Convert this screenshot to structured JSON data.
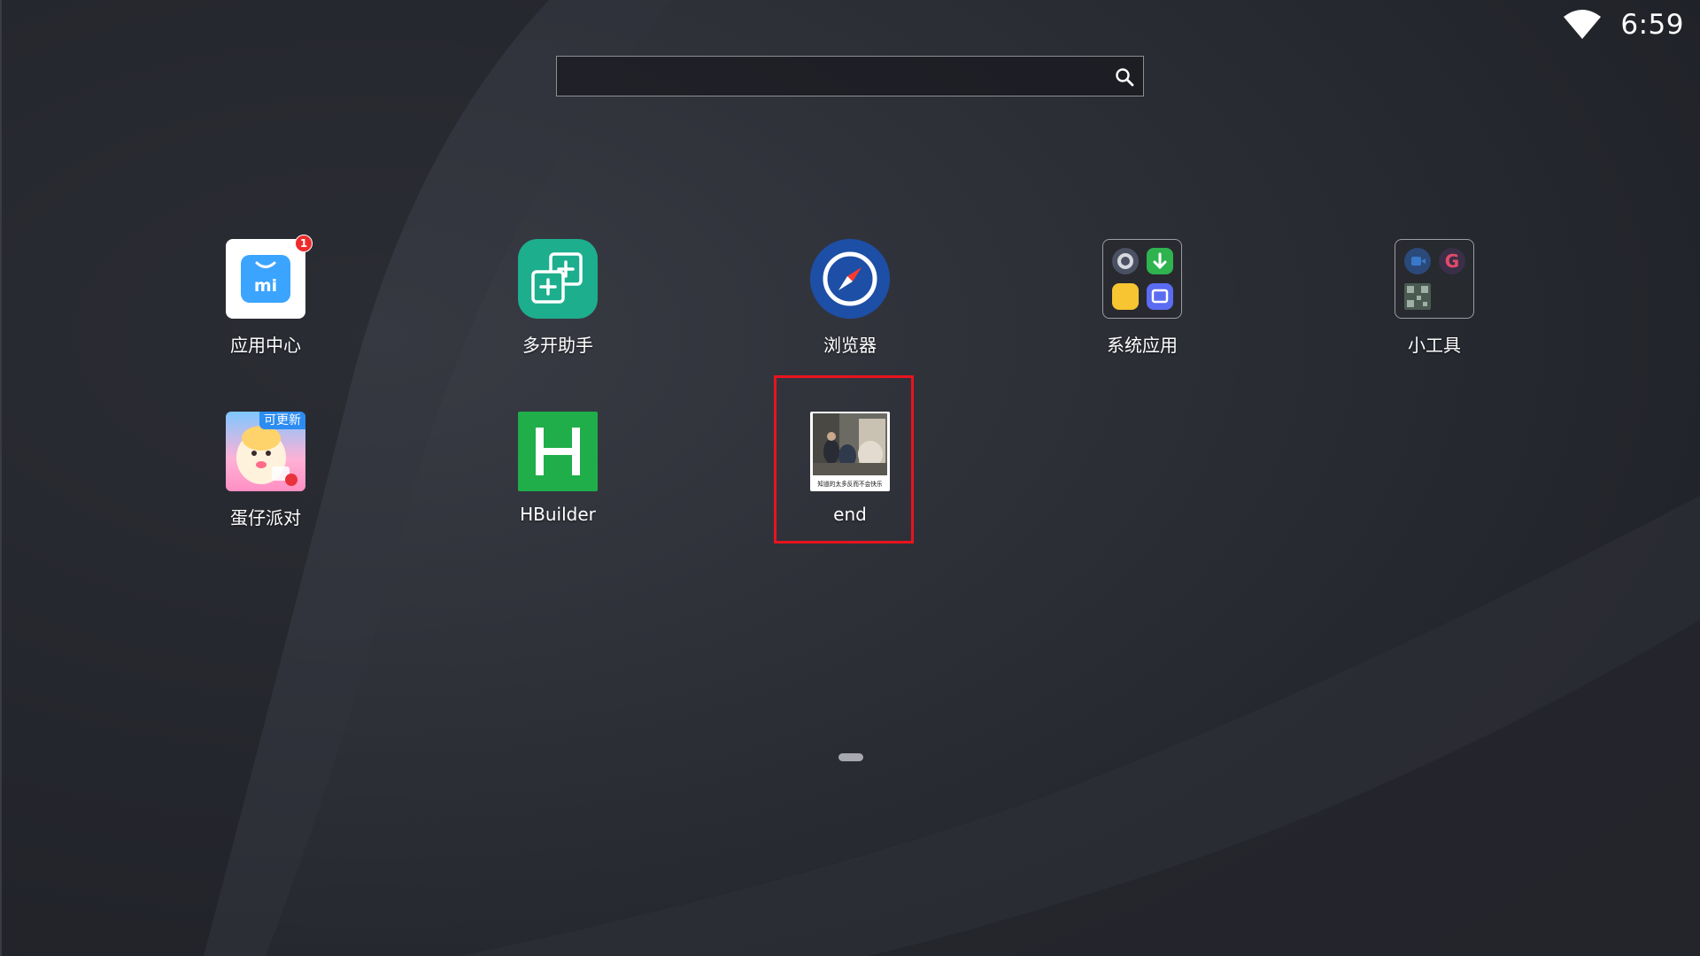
{
  "status_bar": {
    "time": "6:59",
    "wifi_icon": "wifi-icon"
  },
  "search": {
    "value": "",
    "placeholder": "",
    "icon": "search-icon"
  },
  "apps": [
    {
      "label": "应用中心",
      "icon": "app-center-icon",
      "badge": "1"
    },
    {
      "label": "多开助手",
      "icon": "multi-open-icon"
    },
    {
      "label": "浏览器",
      "icon": "compass-icon"
    },
    {
      "label": "系统应用",
      "icon": "system-apps-folder-icon"
    },
    {
      "label": "小工具",
      "icon": "tools-folder-icon"
    },
    {
      "label": "蛋仔派对",
      "icon": "eggy-party-icon",
      "badge": "可更新"
    },
    {
      "label": "HBuilder",
      "icon": "hbuilder-icon"
    },
    {
      "label": "end",
      "icon": "end-meme-icon",
      "caption": "知道的太多反而不会快乐"
    }
  ],
  "colors": {
    "background": "#25272e",
    "highlight": "#e8141e",
    "app_center_blue": "#3ba4ff",
    "multi_open_green": "#1dae8e",
    "browser_blue": "#1d4fa6",
    "hbuilder_green": "#1fae4a",
    "badge_red": "#ee2b2b",
    "update_blue": "#2c8cf2"
  }
}
